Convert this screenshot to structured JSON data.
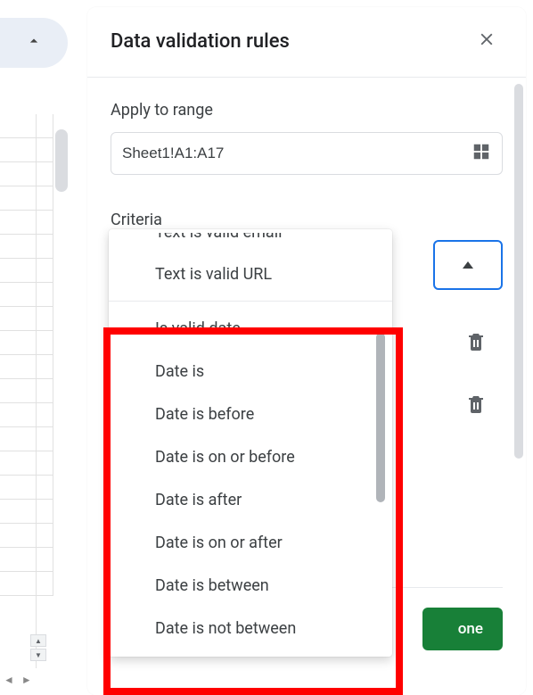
{
  "collapse_icon": "chevron-up",
  "panel": {
    "title": "Data validation rules",
    "close_icon": "close"
  },
  "apply_to_range": {
    "label": "Apply to range",
    "value": "Sheet1!A1:A17",
    "picker_icon": "grid"
  },
  "criteria": {
    "label": "Criteria",
    "dropdown_open": true,
    "cutoff_option": "Text is valid email",
    "visible_upper": [
      "Text is valid URL"
    ],
    "date_options": [
      "Is valid date",
      "Date is",
      "Date is before",
      "Date is on or before",
      "Date is after",
      "Date is on or after",
      "Date is between",
      "Date is not between"
    ]
  },
  "trash_icon": "delete",
  "done_label": "one",
  "highlight": {
    "color": "#ff0000",
    "surrounds": "date_options"
  }
}
